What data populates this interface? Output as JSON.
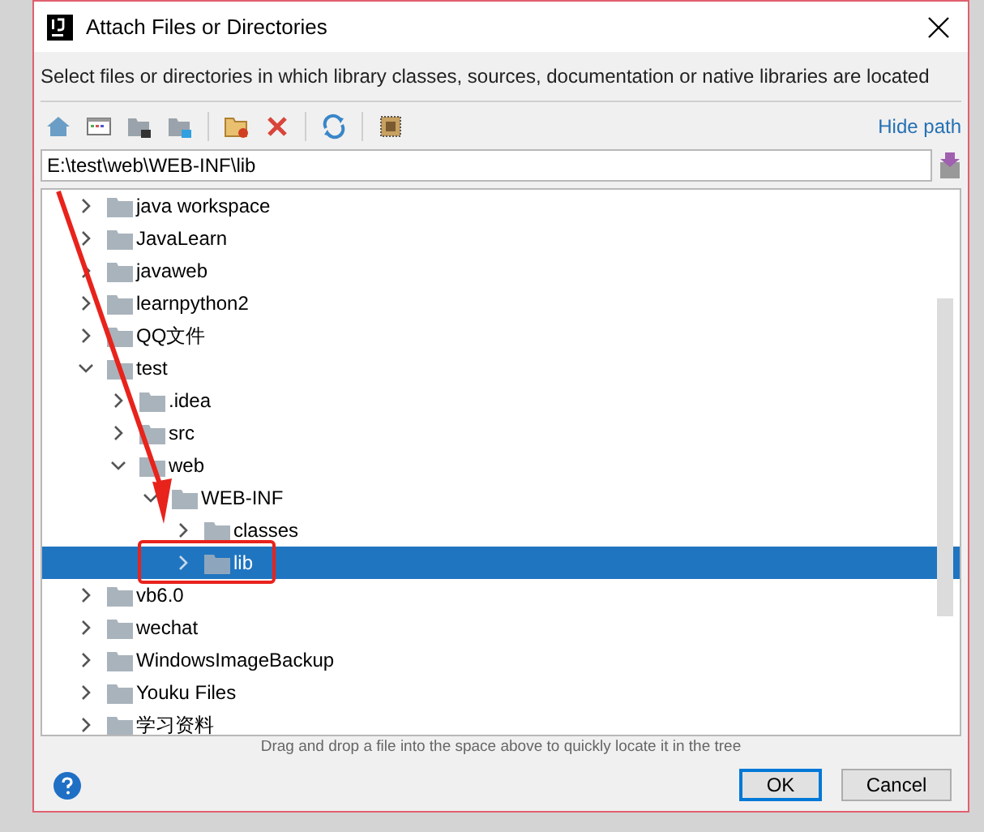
{
  "window": {
    "title": "Attach Files or Directories"
  },
  "description": "Select files or directories in which library classes, sources, documentation or native libraries are located",
  "toolbar": {
    "link": "Hide path"
  },
  "path_field": {
    "value": "E:\\test\\web\\WEB-INF\\lib"
  },
  "tree": [
    {
      "label": "java workspace",
      "expanded": false,
      "selected": false
    },
    {
      "label": "JavaLearn",
      "expanded": false,
      "selected": false
    },
    {
      "label": "javaweb",
      "expanded": false,
      "selected": false
    },
    {
      "label": "learnpython2",
      "expanded": false,
      "selected": false
    },
    {
      "label": "QQ文件",
      "expanded": false,
      "selected": false
    },
    {
      "label": "test",
      "expanded": true,
      "selected": false,
      "children": [
        {
          "label": ".idea",
          "expanded": false,
          "selected": false
        },
        {
          "label": "src",
          "expanded": false,
          "selected": false
        },
        {
          "label": "web",
          "expanded": true,
          "selected": false,
          "children": [
            {
              "label": "WEB-INF",
              "expanded": true,
              "selected": false,
              "children": [
                {
                  "label": "classes",
                  "expanded": false,
                  "selected": false
                },
                {
                  "label": "lib",
                  "expanded": false,
                  "selected": true
                }
              ]
            }
          ]
        }
      ]
    },
    {
      "label": "vb6.0",
      "expanded": false,
      "selected": false
    },
    {
      "label": "wechat",
      "expanded": false,
      "selected": false
    },
    {
      "label": "WindowsImageBackup",
      "expanded": false,
      "selected": false
    },
    {
      "label": "Youku Files",
      "expanded": false,
      "selected": false
    },
    {
      "label": "学习资料",
      "expanded": false,
      "selected": false
    }
  ],
  "hint": "Drag and drop a file into the space above to quickly locate it in the tree",
  "buttons": [
    {
      "label": "OK",
      "default": true
    },
    {
      "label": "Cancel",
      "default": false
    }
  ]
}
